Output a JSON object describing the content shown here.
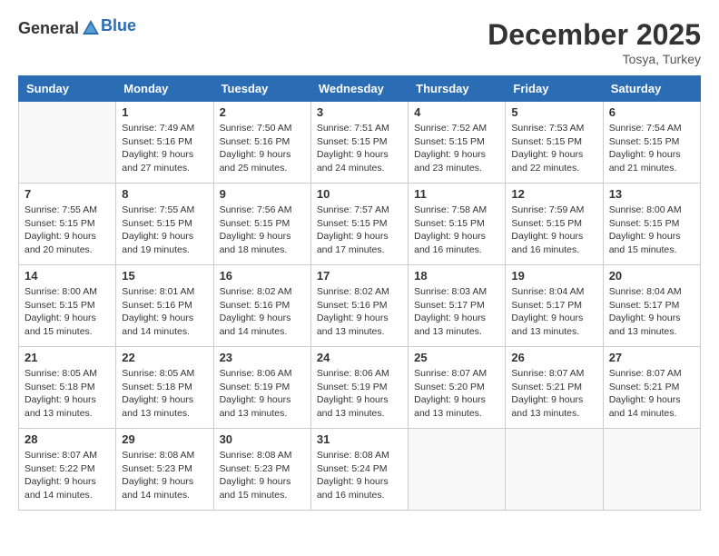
{
  "header": {
    "logo_general": "General",
    "logo_blue": "Blue",
    "month": "December 2025",
    "location": "Tosya, Turkey"
  },
  "weekdays": [
    "Sunday",
    "Monday",
    "Tuesday",
    "Wednesday",
    "Thursday",
    "Friday",
    "Saturday"
  ],
  "weeks": [
    [
      {
        "day": "",
        "sunrise": "",
        "sunset": "",
        "daylight": ""
      },
      {
        "day": "1",
        "sunrise": "Sunrise: 7:49 AM",
        "sunset": "Sunset: 5:16 PM",
        "daylight": "Daylight: 9 hours and 27 minutes."
      },
      {
        "day": "2",
        "sunrise": "Sunrise: 7:50 AM",
        "sunset": "Sunset: 5:16 PM",
        "daylight": "Daylight: 9 hours and 25 minutes."
      },
      {
        "day": "3",
        "sunrise": "Sunrise: 7:51 AM",
        "sunset": "Sunset: 5:15 PM",
        "daylight": "Daylight: 9 hours and 24 minutes."
      },
      {
        "day": "4",
        "sunrise": "Sunrise: 7:52 AM",
        "sunset": "Sunset: 5:15 PM",
        "daylight": "Daylight: 9 hours and 23 minutes."
      },
      {
        "day": "5",
        "sunrise": "Sunrise: 7:53 AM",
        "sunset": "Sunset: 5:15 PM",
        "daylight": "Daylight: 9 hours and 22 minutes."
      },
      {
        "day": "6",
        "sunrise": "Sunrise: 7:54 AM",
        "sunset": "Sunset: 5:15 PM",
        "daylight": "Daylight: 9 hours and 21 minutes."
      }
    ],
    [
      {
        "day": "7",
        "sunrise": "Sunrise: 7:55 AM",
        "sunset": "Sunset: 5:15 PM",
        "daylight": "Daylight: 9 hours and 20 minutes."
      },
      {
        "day": "8",
        "sunrise": "Sunrise: 7:55 AM",
        "sunset": "Sunset: 5:15 PM",
        "daylight": "Daylight: 9 hours and 19 minutes."
      },
      {
        "day": "9",
        "sunrise": "Sunrise: 7:56 AM",
        "sunset": "Sunset: 5:15 PM",
        "daylight": "Daylight: 9 hours and 18 minutes."
      },
      {
        "day": "10",
        "sunrise": "Sunrise: 7:57 AM",
        "sunset": "Sunset: 5:15 PM",
        "daylight": "Daylight: 9 hours and 17 minutes."
      },
      {
        "day": "11",
        "sunrise": "Sunrise: 7:58 AM",
        "sunset": "Sunset: 5:15 PM",
        "daylight": "Daylight: 9 hours and 16 minutes."
      },
      {
        "day": "12",
        "sunrise": "Sunrise: 7:59 AM",
        "sunset": "Sunset: 5:15 PM",
        "daylight": "Daylight: 9 hours and 16 minutes."
      },
      {
        "day": "13",
        "sunrise": "Sunrise: 8:00 AM",
        "sunset": "Sunset: 5:15 PM",
        "daylight": "Daylight: 9 hours and 15 minutes."
      }
    ],
    [
      {
        "day": "14",
        "sunrise": "Sunrise: 8:00 AM",
        "sunset": "Sunset: 5:15 PM",
        "daylight": "Daylight: 9 hours and 15 minutes."
      },
      {
        "day": "15",
        "sunrise": "Sunrise: 8:01 AM",
        "sunset": "Sunset: 5:16 PM",
        "daylight": "Daylight: 9 hours and 14 minutes."
      },
      {
        "day": "16",
        "sunrise": "Sunrise: 8:02 AM",
        "sunset": "Sunset: 5:16 PM",
        "daylight": "Daylight: 9 hours and 14 minutes."
      },
      {
        "day": "17",
        "sunrise": "Sunrise: 8:02 AM",
        "sunset": "Sunset: 5:16 PM",
        "daylight": "Daylight: 9 hours and 13 minutes."
      },
      {
        "day": "18",
        "sunrise": "Sunrise: 8:03 AM",
        "sunset": "Sunset: 5:17 PM",
        "daylight": "Daylight: 9 hours and 13 minutes."
      },
      {
        "day": "19",
        "sunrise": "Sunrise: 8:04 AM",
        "sunset": "Sunset: 5:17 PM",
        "daylight": "Daylight: 9 hours and 13 minutes."
      },
      {
        "day": "20",
        "sunrise": "Sunrise: 8:04 AM",
        "sunset": "Sunset: 5:17 PM",
        "daylight": "Daylight: 9 hours and 13 minutes."
      }
    ],
    [
      {
        "day": "21",
        "sunrise": "Sunrise: 8:05 AM",
        "sunset": "Sunset: 5:18 PM",
        "daylight": "Daylight: 9 hours and 13 minutes."
      },
      {
        "day": "22",
        "sunrise": "Sunrise: 8:05 AM",
        "sunset": "Sunset: 5:18 PM",
        "daylight": "Daylight: 9 hours and 13 minutes."
      },
      {
        "day": "23",
        "sunrise": "Sunrise: 8:06 AM",
        "sunset": "Sunset: 5:19 PM",
        "daylight": "Daylight: 9 hours and 13 minutes."
      },
      {
        "day": "24",
        "sunrise": "Sunrise: 8:06 AM",
        "sunset": "Sunset: 5:19 PM",
        "daylight": "Daylight: 9 hours and 13 minutes."
      },
      {
        "day": "25",
        "sunrise": "Sunrise: 8:07 AM",
        "sunset": "Sunset: 5:20 PM",
        "daylight": "Daylight: 9 hours and 13 minutes."
      },
      {
        "day": "26",
        "sunrise": "Sunrise: 8:07 AM",
        "sunset": "Sunset: 5:21 PM",
        "daylight": "Daylight: 9 hours and 13 minutes."
      },
      {
        "day": "27",
        "sunrise": "Sunrise: 8:07 AM",
        "sunset": "Sunset: 5:21 PM",
        "daylight": "Daylight: 9 hours and 14 minutes."
      }
    ],
    [
      {
        "day": "28",
        "sunrise": "Sunrise: 8:07 AM",
        "sunset": "Sunset: 5:22 PM",
        "daylight": "Daylight: 9 hours and 14 minutes."
      },
      {
        "day": "29",
        "sunrise": "Sunrise: 8:08 AM",
        "sunset": "Sunset: 5:23 PM",
        "daylight": "Daylight: 9 hours and 14 minutes."
      },
      {
        "day": "30",
        "sunrise": "Sunrise: 8:08 AM",
        "sunset": "Sunset: 5:23 PM",
        "daylight": "Daylight: 9 hours and 15 minutes."
      },
      {
        "day": "31",
        "sunrise": "Sunrise: 8:08 AM",
        "sunset": "Sunset: 5:24 PM",
        "daylight": "Daylight: 9 hours and 16 minutes."
      },
      {
        "day": "",
        "sunrise": "",
        "sunset": "",
        "daylight": ""
      },
      {
        "day": "",
        "sunrise": "",
        "sunset": "",
        "daylight": ""
      },
      {
        "day": "",
        "sunrise": "",
        "sunset": "",
        "daylight": ""
      }
    ]
  ]
}
